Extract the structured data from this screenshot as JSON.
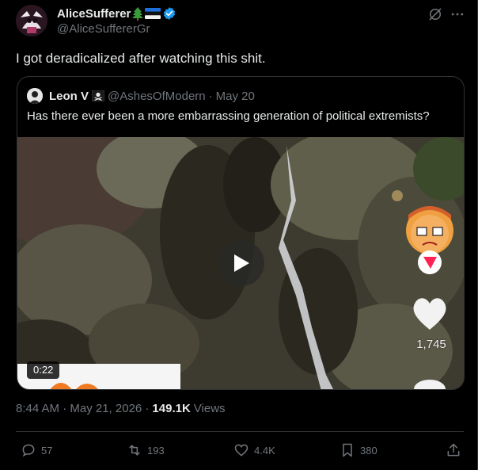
{
  "tweet": {
    "display_name": "AliceSufferer",
    "name_emojis": [
      "evergreen-tree",
      "estonia-flag"
    ],
    "handle": "@AliceSuffererGr",
    "text": "I got deradicalized after watching this shit.",
    "timestamp": "8:44 AM · May 21, 2026 ·",
    "views_count": "149.1K",
    "views_label": "Views"
  },
  "quote": {
    "display_name": "Leon V",
    "name_emoji": "pirate-flag",
    "handle": "@AshesOfModern",
    "separator": "·",
    "date": "May 20",
    "text": "Has there ever been a more embarrassing generation of political extremists?",
    "video": {
      "duration": "0:22",
      "overlay_like_count": "1,745"
    }
  },
  "actions": {
    "replies": "57",
    "reposts": "193",
    "likes": "4.4K",
    "bookmarks": "380"
  },
  "colors": {
    "background": "#000000",
    "text_primary": "#e7e9ea",
    "text_secondary": "#71767b",
    "border": "#2f3336",
    "verified": "#1d9bf0"
  }
}
